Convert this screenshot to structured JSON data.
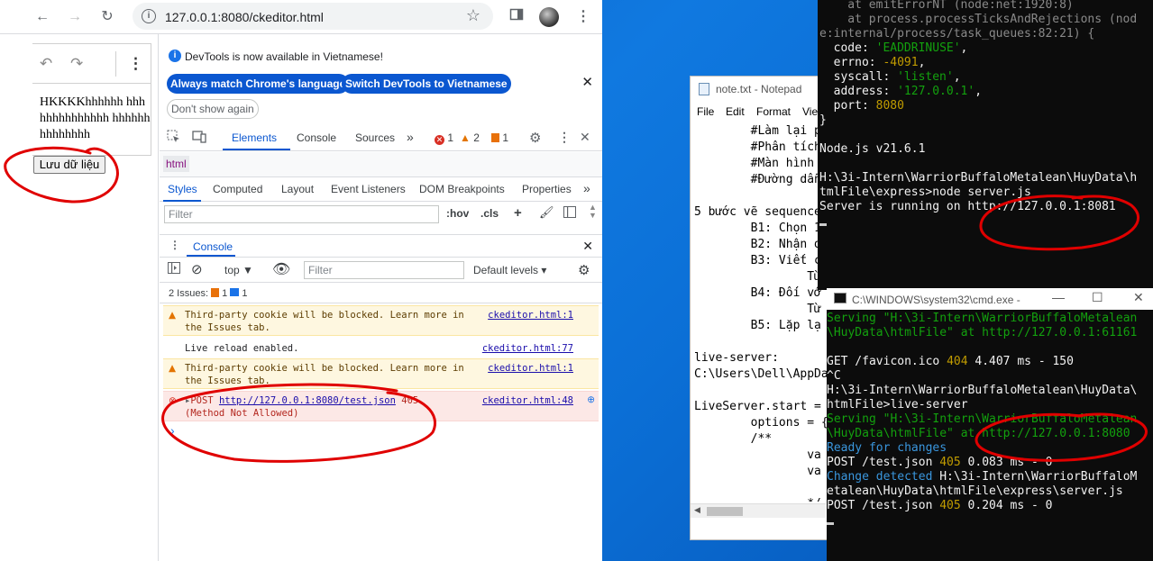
{
  "browser": {
    "url": "127.0.0.1:8080/ckeditor.html",
    "page": {
      "editor_text": "HKKKKhhhhhh hhhhhhhhhhhhhh hhhhhhhhhhhhhh",
      "save_button": "Lưu dữ liệu"
    }
  },
  "devtools": {
    "infobar": {
      "message": "DevTools is now available in Vietnamese!",
      "btn_match": "Always match Chrome's language",
      "btn_switch": "Switch DevTools to Vietnamese",
      "btn_dont_show": "Don't show again"
    },
    "tabs": [
      "Elements",
      "Console",
      "Sources"
    ],
    "counts": {
      "errors": "1",
      "warnings": "2",
      "issues": "1"
    },
    "breadcrumb": "html",
    "style_tabs": [
      "Styles",
      "Computed",
      "Layout",
      "Event Listeners",
      "DOM Breakpoints",
      "Properties"
    ],
    "styles_filter_placeholder": "Filter",
    "hov": ":hov",
    "cls": ".cls",
    "drawer_tab": "Console",
    "console_toolbar": {
      "context": "top",
      "filter_placeholder": "Filter",
      "levels": "Default levels"
    },
    "issues_line": {
      "label": "2 Issues:",
      "warn": "1",
      "info": "1"
    },
    "logs": [
      {
        "type": "warn",
        "text": "Third-party cookie will be blocked. Learn more in the Issues tab.",
        "src": "ckeditor.html:1"
      },
      {
        "type": "info",
        "text": "Live reload enabled.",
        "src": "ckeditor.html:77"
      },
      {
        "type": "warn",
        "text": "Third-party cookie will be blocked. Learn more in the Issues tab.",
        "src": "ckeditor.html:1"
      },
      {
        "type": "error",
        "method": "POST",
        "link": "http://127.0.0.1:8080/test.json",
        "status": "405",
        "detail": "(Method Not Allowed)",
        "src": "ckeditor.html:48"
      }
    ]
  },
  "notepad": {
    "title": "note.txt - Notepad",
    "menu": [
      "File",
      "Edit",
      "Format",
      "View"
    ],
    "lines": [
      "        #Làm lại p",
      "        #Phân tích",
      "        #Màn hình",
      "        #Đường dẫn",
      "",
      "5 bước vẽ sequence",
      "        B1: Chọn 1",
      "        B2: Nhận d",
      "        B3: Viết c",
      "                Từ",
      "        B4: Đối vớ",
      "                Từ",
      "        B5: Lặp lạ",
      "",
      "live-server:",
      "C:\\Users\\Dell\\AppDa",
      "",
      "LiveServer.start =",
      "        options = {",
      "        /**",
      "                va",
      "                va",
      "",
      "                */"
    ]
  },
  "terminal_node": {
    "lines": [
      "    at emitErrorNT (node:net:1920:8)",
      "    at process.processTicksAndRejections (nod",
      "e:internal/process/task_queues:82:21) {",
      "  code: 'EADDRINUSE',",
      "  errno: -4091,",
      "  syscall: 'listen',",
      "  address: '127.0.0.1',",
      "  port: 8080",
      "}",
      "",
      "Node.js v21.6.1",
      "",
      "H:\\3i-Intern\\WarriorBuffaloMetalean\\HuyData\\h",
      "tmlFile\\express>node server.js",
      "Server is running on http://127.0.0.1:8081"
    ]
  },
  "terminal_cmd": {
    "title": "C:\\WINDOWS\\system32\\cmd.exe -",
    "lines": [
      {
        "c": "g",
        "t": "Serving \"H:\\3i-Intern\\WarriorBuffaloMetalean"
      },
      {
        "c": "g",
        "t": "\\HuyData\\htmlFile\" at http://127.0.0.1:61161"
      },
      {
        "c": "n",
        "t": ""
      },
      {
        "c": "n",
        "t": "GET /favicon.ico 404 4.407 ms - 150"
      },
      {
        "c": "n",
        "t": "^C"
      },
      {
        "c": "n",
        "t": "H:\\3i-Intern\\WarriorBuffaloMetalean\\HuyData\\"
      },
      {
        "c": "n",
        "t": "htmlFile>live-server"
      },
      {
        "c": "g",
        "t": "Serving \"H:\\3i-Intern\\WarriorBuffaloMetalean"
      },
      {
        "c": "g",
        "t": "\\HuyData\\htmlFile\" at http://127.0.0.1:8080"
      },
      {
        "c": "c",
        "t": "Ready for changes"
      },
      {
        "c": "n",
        "t": "POST /test.json 405 0.083 ms - 0"
      },
      {
        "c": "c",
        "t": "Change detected H:\\3i-Intern\\WarriorBuffaloM"
      },
      {
        "c": "n",
        "t": "etalean\\HuyData\\htmlFile\\express\\server.js"
      },
      {
        "c": "n",
        "t": "POST /test.json 405 0.204 ms - 0"
      }
    ]
  },
  "colors": {
    "accent": "#0b57d0",
    "annotation": "#e00000",
    "desktop": "#1079e0"
  }
}
